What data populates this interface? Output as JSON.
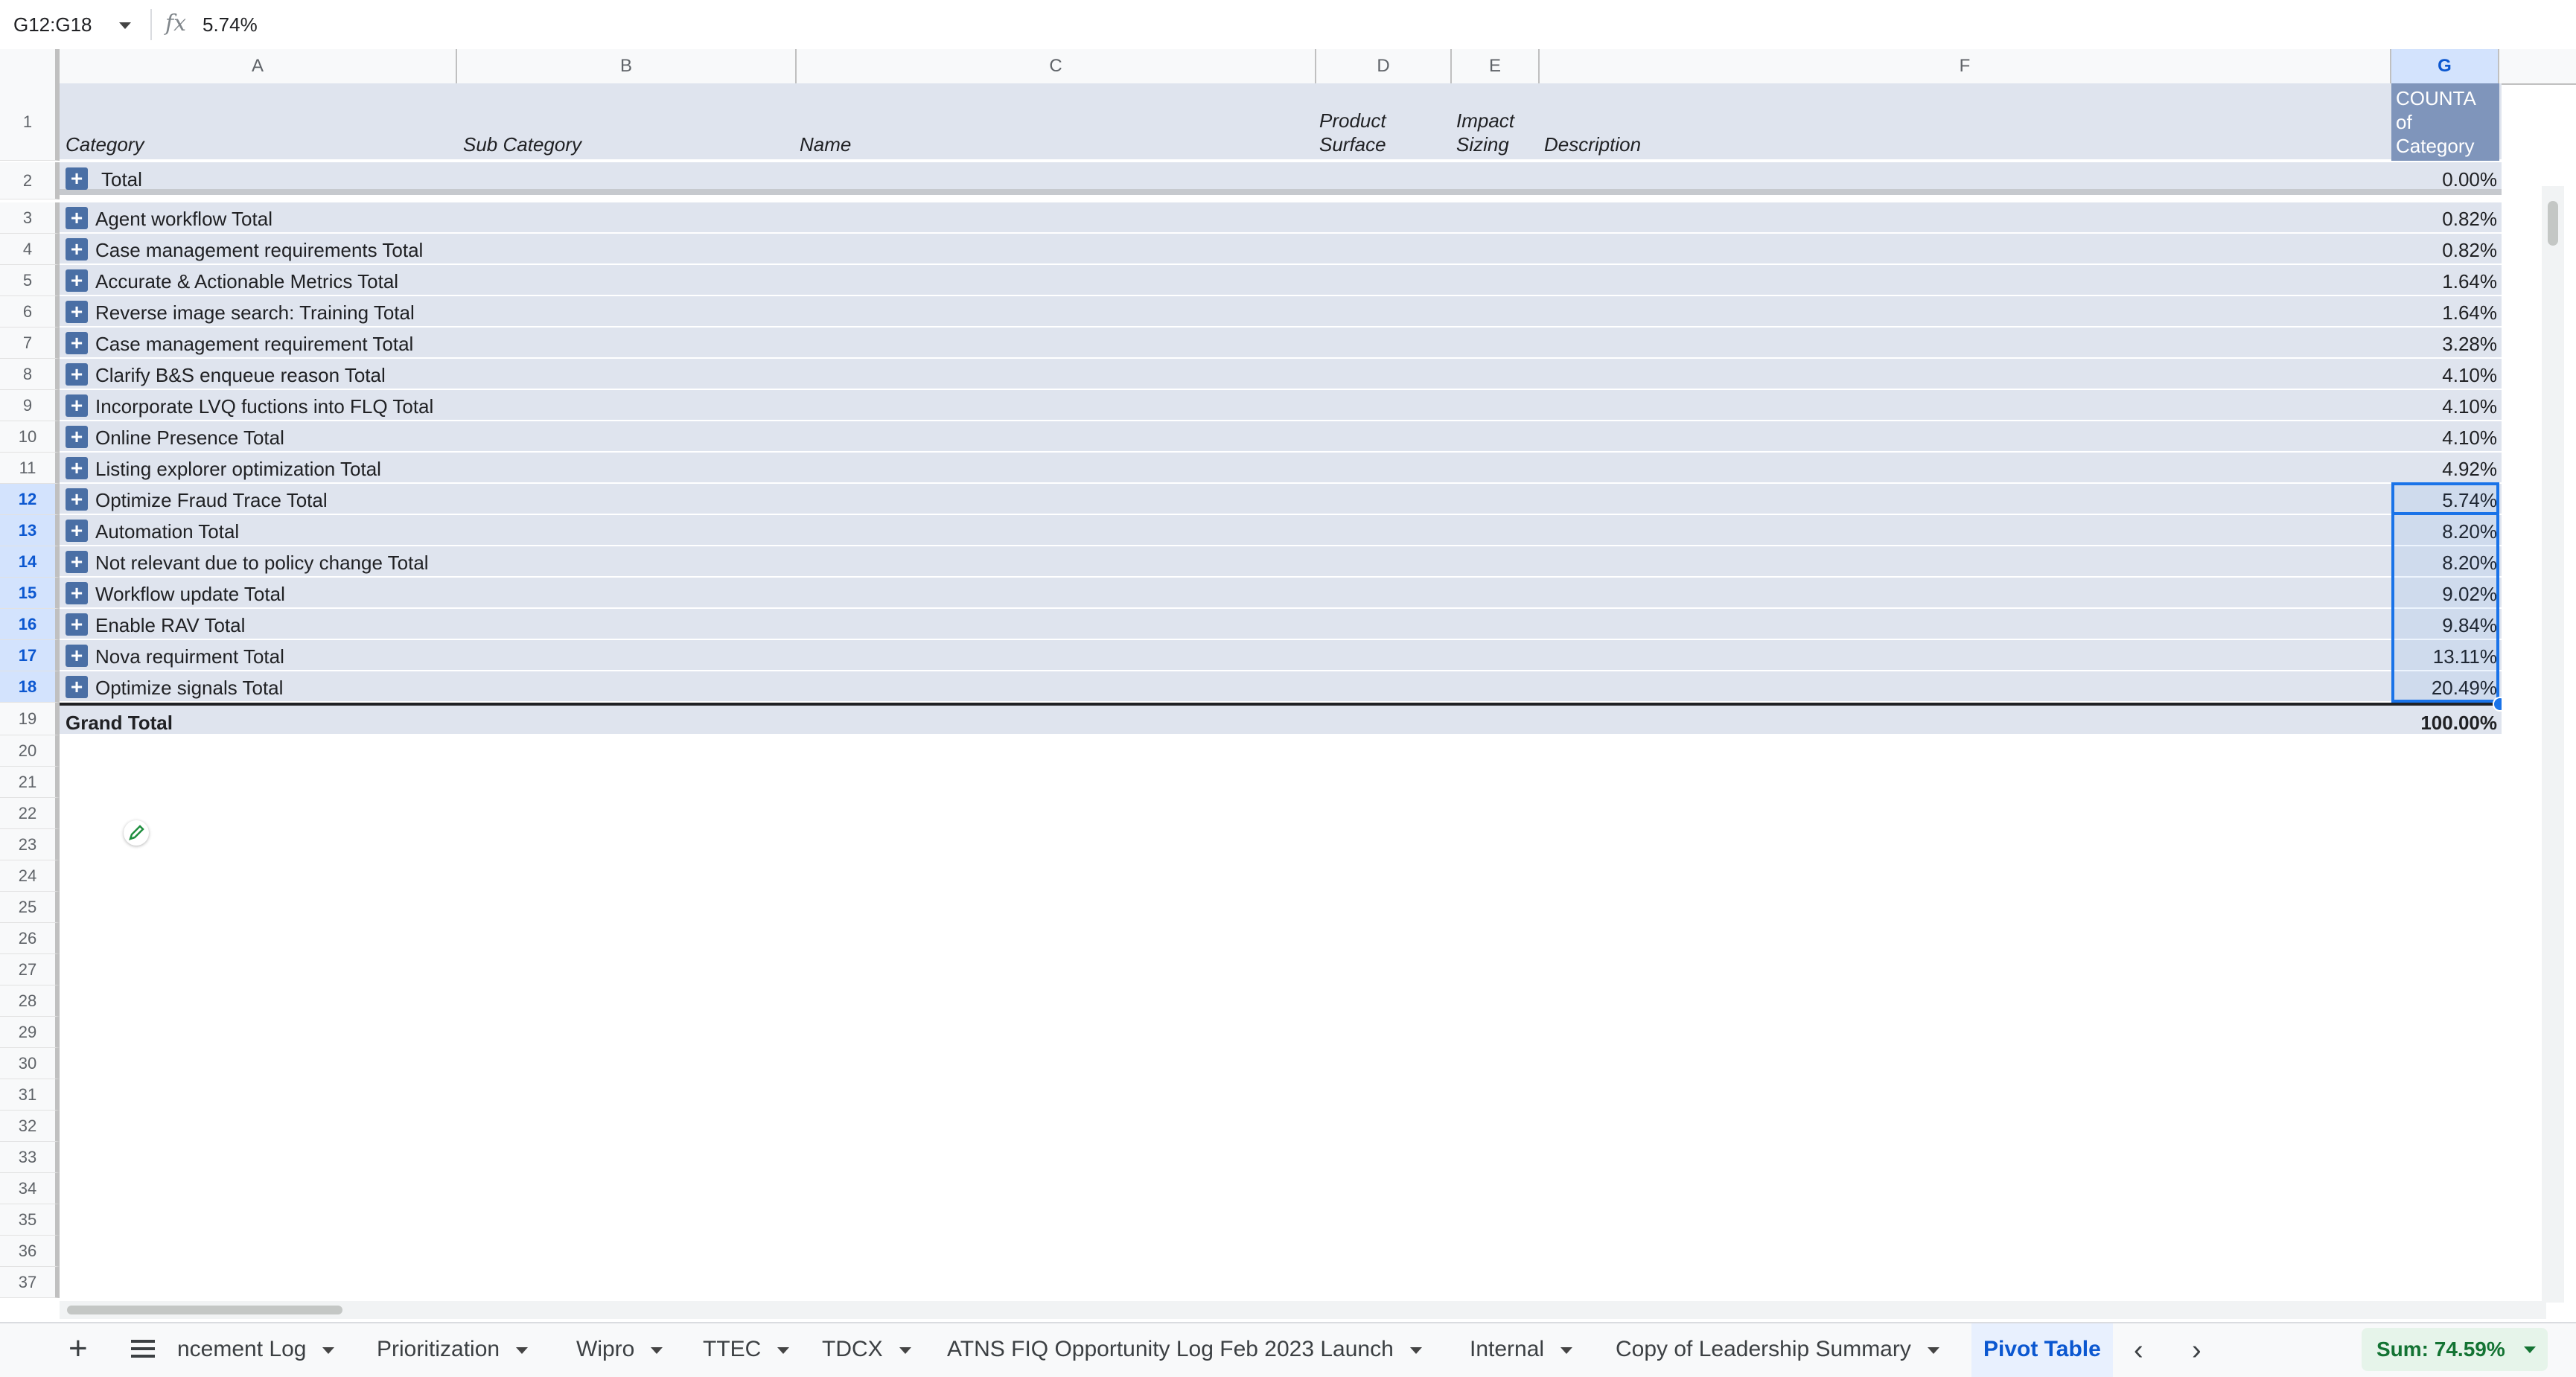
{
  "formula_bar": {
    "name_box": "G12:G18",
    "fx": "fx",
    "value": "5.74%"
  },
  "columns": [
    "A",
    "B",
    "C",
    "D",
    "E",
    "F",
    "G"
  ],
  "pivot_headers": {
    "category": "Category",
    "sub_category": "Sub Category",
    "name": "Name",
    "product_surface_1": "Product",
    "product_surface_2": "Surface",
    "impact_sizing_1": "Impact",
    "impact_sizing_2": "Sizing",
    "description": "Description",
    "value_1": "COUNTA",
    "value_2": "of",
    "value_3": "Category"
  },
  "total_row": {
    "label": "Total",
    "value": "0.00%"
  },
  "rows": [
    {
      "label": "Agent workflow  Total",
      "value": "0.82%"
    },
    {
      "label": "Case management requirements Total",
      "value": "0.82%"
    },
    {
      "label": "Accurate & Actionable Metrics   Total",
      "value": "1.64%"
    },
    {
      "label": "Reverse image search: Training Total",
      "value": "1.64%"
    },
    {
      "label": "Case management requirement  Total",
      "value": "3.28%"
    },
    {
      "label": "Clarify B&S enqueue reason Total",
      "value": "4.10%"
    },
    {
      "label": "Incorporate LVQ fuctions into FLQ Total",
      "value": "4.10%"
    },
    {
      "label": "Online Presence Total",
      "value": "4.10%"
    },
    {
      "label": "Listing explorer optimization Total",
      "value": "4.92%"
    },
    {
      "label": "Optimize Fraud Trace Total",
      "value": "5.74%"
    },
    {
      "label": "Automation Total",
      "value": "8.20%"
    },
    {
      "label": "Not relevant due to policy change Total",
      "value": "8.20%"
    },
    {
      "label": "Workflow update Total",
      "value": "9.02%"
    },
    {
      "label": "Enable RAV  Total",
      "value": "9.84%"
    },
    {
      "label": "Nova requirment  Total",
      "value": "13.11%"
    },
    {
      "label": "Optimize signals Total",
      "value": "20.49%"
    }
  ],
  "grand_total": {
    "label": "Grand Total",
    "value": "100.00%"
  },
  "row_numbers": [
    "1",
    "2",
    "3",
    "4",
    "5",
    "6",
    "7",
    "8",
    "9",
    "10",
    "11",
    "12",
    "13",
    "14",
    "15",
    "16",
    "17",
    "18",
    "19",
    "20",
    "21",
    "22",
    "23",
    "24",
    "25",
    "26",
    "27",
    "28",
    "29",
    "30",
    "31",
    "32",
    "33",
    "34",
    "35",
    "36",
    "37"
  ],
  "selected_rows": [
    "12",
    "13",
    "14",
    "15",
    "16",
    "17",
    "18"
  ],
  "sheet_tabs": [
    {
      "label": "ncement Log"
    },
    {
      "label": "Prioritization"
    },
    {
      "label": "Wipro"
    },
    {
      "label": "TTEC"
    },
    {
      "label": "TDCX"
    },
    {
      "label": "ATNS FIQ Opportunity Log Feb 2023 Launch"
    },
    {
      "label": "Internal"
    },
    {
      "label": "Copy of Leadership Summary"
    }
  ],
  "active_tab": "Pivot Table",
  "sum_label": "Sum: 74.59%",
  "icons": {
    "add_sheet": "+",
    "prev": "‹",
    "next": "›",
    "expand": "+"
  },
  "colors": {
    "band": "#dfe4ee",
    "expander": "#4a6fa5",
    "selection": "#1a73e8",
    "header_value": "#7f95bb"
  }
}
